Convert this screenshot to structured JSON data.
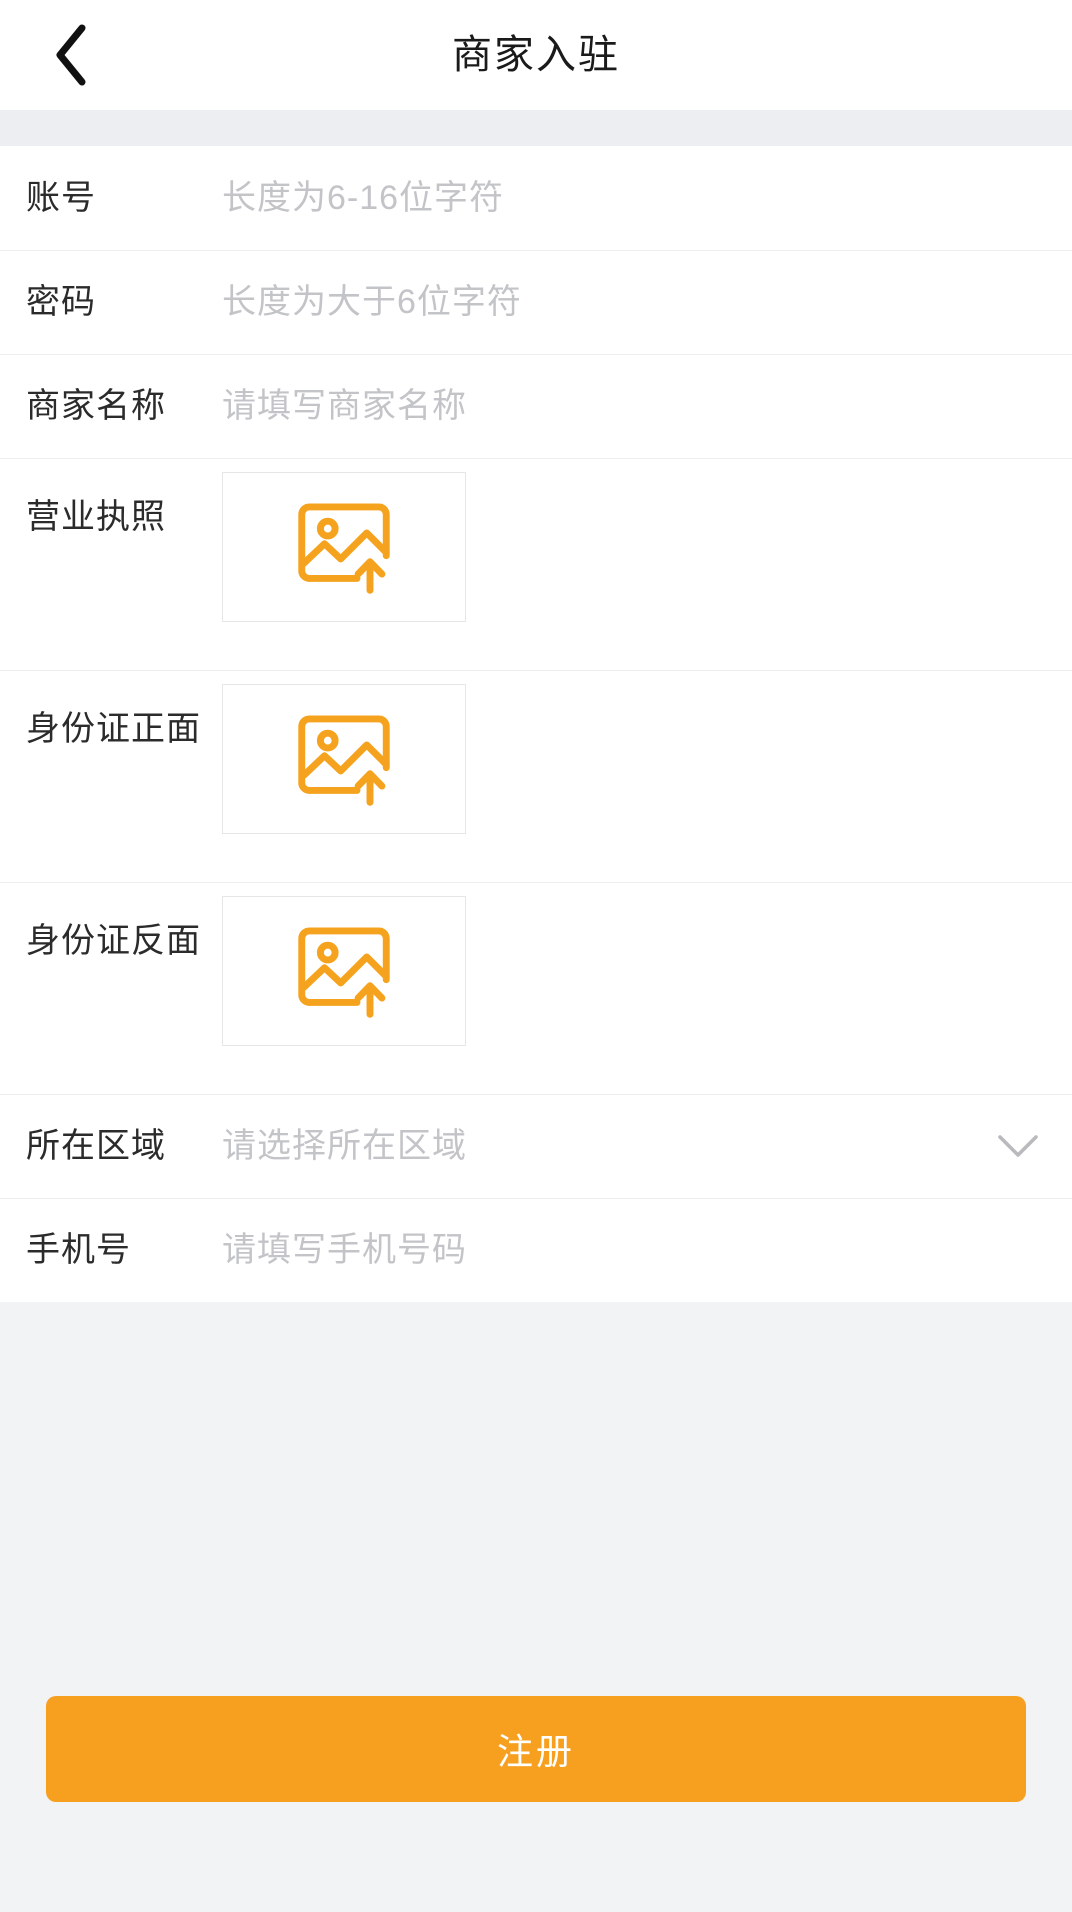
{
  "header": {
    "title": "商家入驻",
    "back_icon": "chevron-left-icon"
  },
  "form": {
    "fields": [
      {
        "key": "account",
        "type": "text",
        "label": "账号",
        "placeholder": "长度为6-16位字符",
        "value": ""
      },
      {
        "key": "password",
        "type": "password",
        "label": "密码",
        "placeholder": "长度为大于6位字符",
        "value": ""
      },
      {
        "key": "merchant_name",
        "type": "text",
        "label": "商家名称",
        "placeholder": "请填写商家名称",
        "value": ""
      },
      {
        "key": "business_license",
        "type": "upload",
        "label": "营业执照",
        "upload_icon": "image-upload-icon",
        "value": ""
      },
      {
        "key": "id_card_front",
        "type": "upload",
        "label": "身份证正面",
        "upload_icon": "image-upload-icon",
        "value": ""
      },
      {
        "key": "id_card_back",
        "type": "upload",
        "label": "身份证反面",
        "upload_icon": "image-upload-icon",
        "value": ""
      },
      {
        "key": "region",
        "type": "select",
        "label": "所在区域",
        "placeholder": "请选择所在区域",
        "value": "",
        "chevron_icon": "chevron-down-icon"
      },
      {
        "key": "phone",
        "type": "tel",
        "label": "手机号",
        "placeholder": "请填写手机号码",
        "value": ""
      }
    ]
  },
  "footer": {
    "submit_label": "注册"
  },
  "colors": {
    "accent": "#f7a020",
    "upload_icon": "#f5a31e",
    "page_bg": "#f2f3f5",
    "card_bg": "#ffffff",
    "label_text": "#2b2b2b",
    "placeholder_text": "#c3c4c8",
    "divider": "#ededed"
  }
}
